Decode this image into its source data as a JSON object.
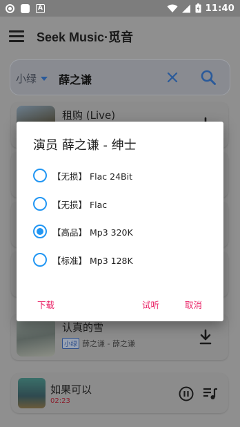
{
  "status_bar": {
    "time": "11:40",
    "icons": [
      "record-icon",
      "square-icon",
      "a-icon",
      "wifi-icon",
      "signal-icon",
      "battery-icon"
    ]
  },
  "app_bar": {
    "title": "Seek Music·觅音"
  },
  "search": {
    "source": "小绿",
    "query": "薛之谦"
  },
  "list": [
    {
      "title": "租购 (Live)",
      "tag": "",
      "artist": ""
    },
    {
      "title": "认真的雪",
      "tag": "小绿",
      "artist": "薛之谦 - 薛之谦"
    }
  ],
  "player": {
    "title": "如果可以",
    "time": "02:23"
  },
  "dialog": {
    "title": "演员 薛之谦 - 绅士",
    "options": [
      {
        "label": "【无损】 Flac 24Bit",
        "selected": false
      },
      {
        "label": "【无损】 Flac",
        "selected": false
      },
      {
        "label": "【高品】 Mp3 320K",
        "selected": true
      },
      {
        "label": "【标准】 Mp3 128K",
        "selected": false
      }
    ],
    "buttons": {
      "download": "下载",
      "preview": "试听",
      "cancel": "取消"
    }
  },
  "colors": {
    "accent": "#2196f3",
    "button": "#e91e63",
    "scrim": "#8f8f8f"
  }
}
